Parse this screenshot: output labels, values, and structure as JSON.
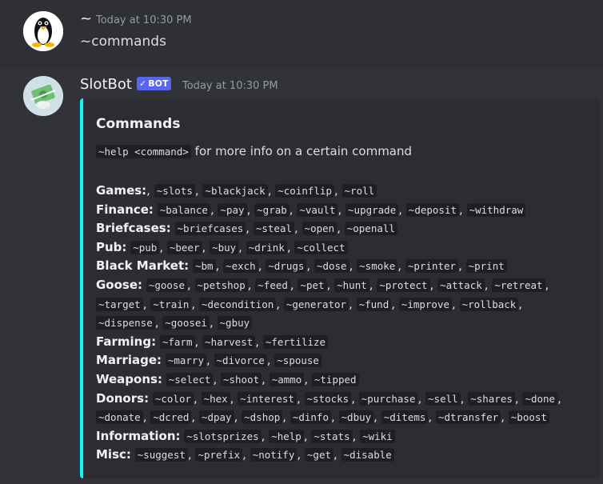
{
  "messages": {
    "user": {
      "username": "~",
      "timestamp": "Today at 10:30 PM",
      "content": "~commands"
    },
    "bot": {
      "username": "SlotBot",
      "badge": "BOT",
      "timestamp": "Today at 10:30 PM",
      "embed": {
        "accent_color": "#00ffff",
        "title": "Commands",
        "help_code": "~help <command>",
        "help_text": "for more info on a certain command",
        "categories": [
          {
            "label": "Games:",
            "lines": [
              [
                ",",
                "~slots",
                "~blackjack",
                "~coinflip",
                "~roll"
              ]
            ]
          },
          {
            "label": "Finance:",
            "lines": [
              [
                "~balance",
                "~pay",
                "~grab",
                "~vault",
                "~upgrade",
                "~deposit",
                "~withdraw"
              ]
            ]
          },
          {
            "label": "Briefcases:",
            "lines": [
              [
                "~briefcases",
                "~steal",
                "~open",
                "~openall"
              ]
            ]
          },
          {
            "label": "Pub:",
            "lines": [
              [
                "~pub",
                "~beer",
                "~buy",
                "~drink",
                "~collect"
              ]
            ]
          },
          {
            "label": "Black Market:",
            "lines": [
              [
                "~bm",
                "~exch",
                "~drugs",
                "~dose",
                "~smoke",
                "~printer",
                "~print"
              ]
            ]
          },
          {
            "label": "Goose:",
            "lines": [
              [
                "~goose",
                "~petshop",
                "~feed",
                "~pet",
                "~hunt",
                "~protect",
                "~attack",
                "~retreat"
              ],
              [
                "~target",
                "~train",
                "~decondition",
                "~generator",
                "~fund",
                "~improve",
                "~rollback"
              ],
              [
                "~dispense",
                "~goosei",
                "~gbuy"
              ]
            ]
          },
          {
            "label": "Farming:",
            "lines": [
              [
                "~farm",
                "~harvest",
                "~fertilize"
              ]
            ]
          },
          {
            "label": "Marriage:",
            "lines": [
              [
                "~marry",
                "~divorce",
                "~spouse"
              ]
            ]
          },
          {
            "label": "Weapons:",
            "lines": [
              [
                "~select",
                "~shoot",
                "~ammo",
                "~tipped"
              ]
            ]
          },
          {
            "label": "Donors:",
            "lines": [
              [
                "~color",
                "~hex",
                "~interest",
                "~stocks",
                "~purchase",
                "~sell",
                "~shares",
                "~done"
              ],
              [
                "~donate",
                "~dcred",
                "~dpay",
                "~dshop",
                "~dinfo",
                "~dbuy",
                "~ditems",
                "~dtransfer",
                "~boost"
              ]
            ]
          },
          {
            "label": "Information:",
            "lines": [
              [
                "~slotsprizes",
                "~help",
                "~stats",
                "~wiki"
              ]
            ]
          },
          {
            "label": "Misc:",
            "lines": [
              [
                "~suggest",
                "~prefix",
                "~notify",
                "~get",
                "~disable"
              ]
            ]
          }
        ]
      }
    }
  }
}
